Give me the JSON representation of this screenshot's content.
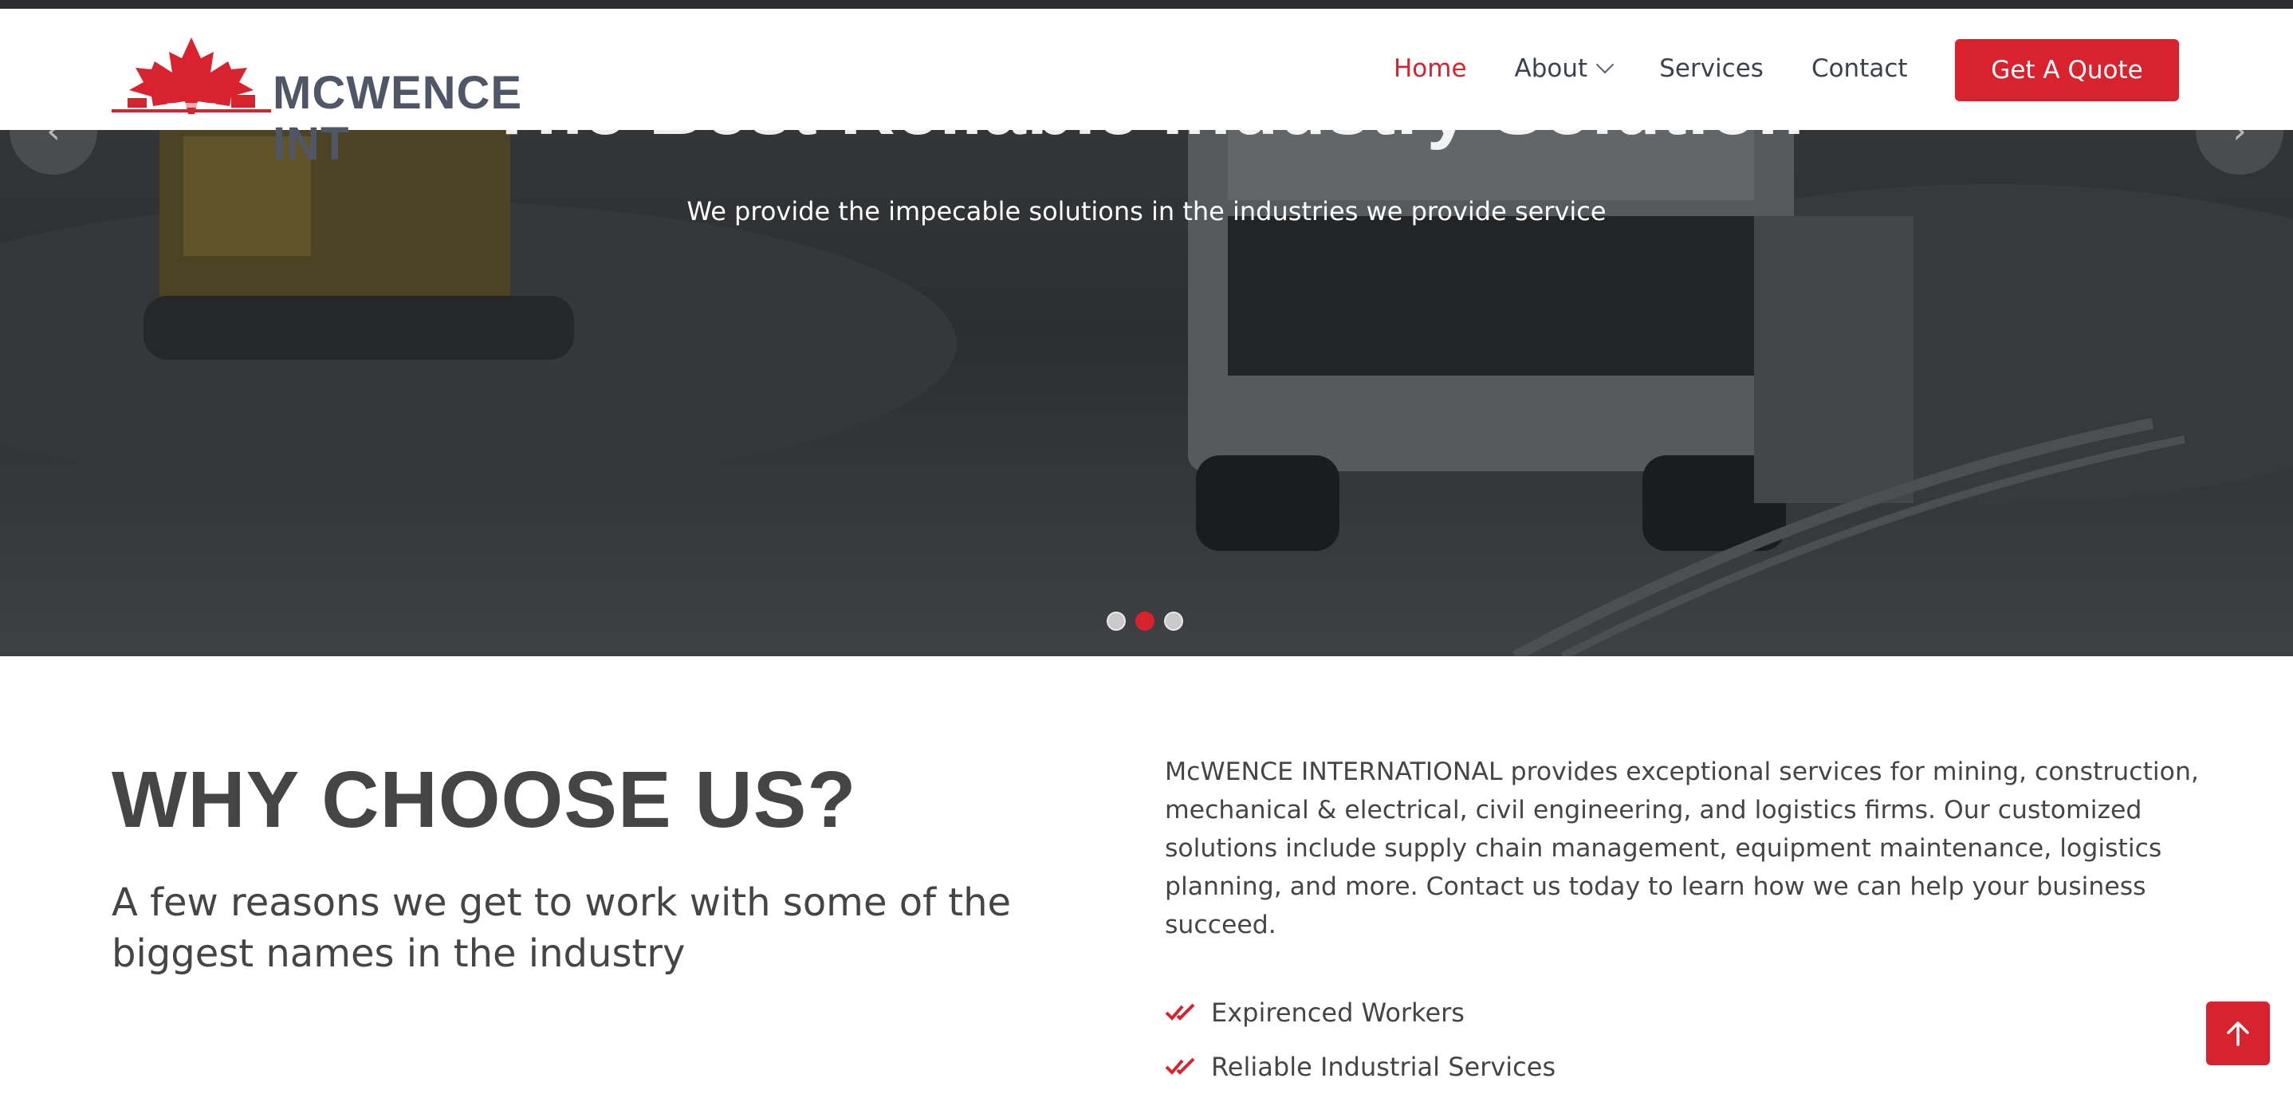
{
  "brand": {
    "name": "MCWENCE INT",
    "accent_color": "#d8232f",
    "text_color": "#4f5766"
  },
  "nav": {
    "items": [
      {
        "label": "Home",
        "active": true
      },
      {
        "label": "About",
        "has_dropdown": true
      },
      {
        "label": "Services"
      },
      {
        "label": "Contact"
      }
    ],
    "cta_label": "Get A Quote"
  },
  "hero": {
    "title": "The Best Reliable Industry Solution",
    "subtitle": "We provide the impecable solutions in the industries we provide service",
    "prev_icon": "chevron-left-icon",
    "next_icon": "chevron-right-icon",
    "slide_count": 3,
    "active_slide": 2
  },
  "why": {
    "title": "WHY CHOOSE US?",
    "subtitle": "A few reasons we get to work with some of the biggest names in the industry",
    "description": "McWENCE INTERNATIONAL provides exceptional services for mining, construction, mechanical & electrical, civil engineering, and logistics firms. Our customized solutions include supply chain management, equipment maintenance, logistics planning, and more. Contact us today to learn how we can help your business succeed.",
    "features": [
      "Expirenced Workers",
      "Reliable Industrial Services"
    ]
  },
  "scroll_top_icon": "arrow-up-icon"
}
